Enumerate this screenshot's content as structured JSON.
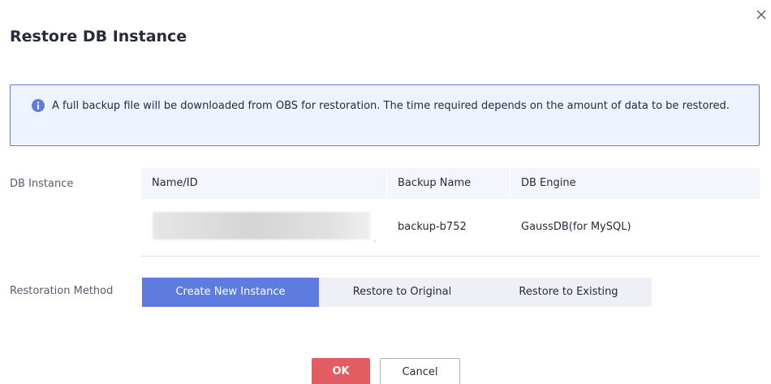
{
  "dialog": {
    "title": "Restore DB Instance",
    "close_icon": "close-icon"
  },
  "notice": {
    "icon": "info-icon",
    "text": "A full backup file will be downloaded from OBS for restoration. The time required depends on the amount of data to be restored."
  },
  "db_instance": {
    "label": "DB Instance",
    "columns": [
      "Name/ID",
      "Backup Name",
      "DB Engine"
    ],
    "rows": [
      {
        "name_id": "",
        "backup_name": "backup-b752",
        "db_engine": "GaussDB(for MySQL)"
      }
    ]
  },
  "restoration_method": {
    "label": "Restoration Method",
    "options": [
      "Create New Instance",
      "Restore to Original",
      "Restore to Existing"
    ],
    "selected": "Create New Instance"
  },
  "footer": {
    "ok_label": "OK",
    "cancel_label": "Cancel"
  },
  "colors": {
    "primary": "#5e7ce0",
    "danger": "#e15d62",
    "info_bg": "#edf3ff"
  }
}
